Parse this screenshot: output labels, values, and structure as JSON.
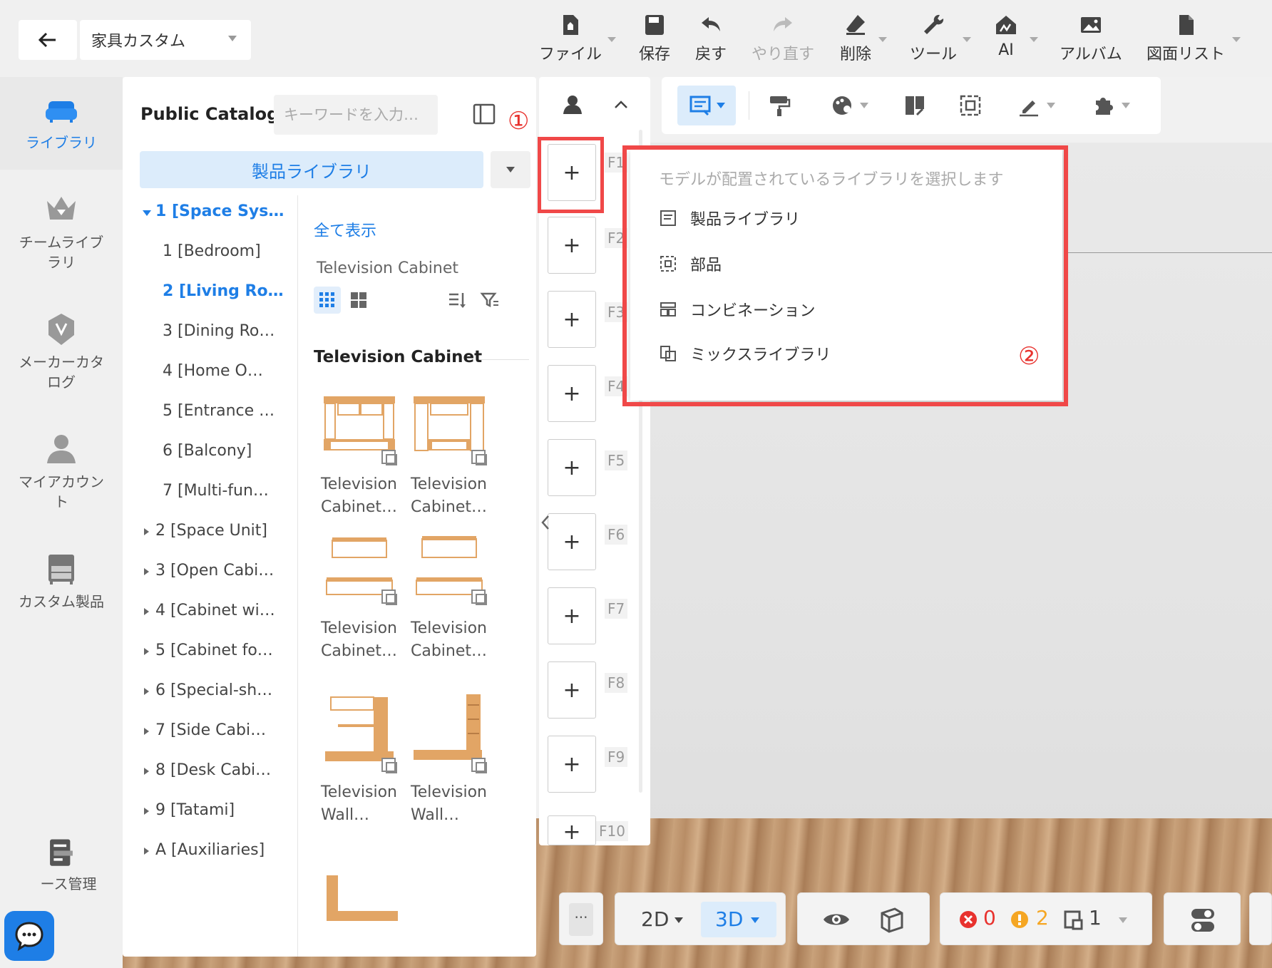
{
  "header": {
    "project_name": "家具カスタム",
    "tools": [
      {
        "label": "ファイル"
      },
      {
        "label": "保存"
      },
      {
        "label": "戻す"
      },
      {
        "label": "やり直す"
      },
      {
        "label": "削除"
      },
      {
        "label": "ツール"
      },
      {
        "label": "AI"
      },
      {
        "label": "アルバム"
      },
      {
        "label": "図面リスト"
      }
    ]
  },
  "sidebar": {
    "items": [
      {
        "label": "ライブラリ"
      },
      {
        "label": "チームライブラリ"
      },
      {
        "label": "メーカーカタログ"
      },
      {
        "label": "マイアカウント"
      },
      {
        "label": "カスタム製品"
      },
      {
        "label": "ース管理"
      }
    ]
  },
  "catalog": {
    "title": "Public Catalog",
    "search_placeholder": "キーワードを入力…",
    "annotation_1": "①",
    "library_select": "製品ライブラリ",
    "tree": [
      "1 [Space Sys…",
      "1 [Bedroom]",
      "2 [Living Ro…",
      "3 [Dining Ro…",
      "4 [Home O…",
      "5 [Entrance …",
      "6 [Balcony]",
      "7 [Multi-fun…",
      "2 [Space Unit]",
      "3 [Open Cabi…",
      "4 [Cabinet wi…",
      "5 [Cabinet fo…",
      "6 [Special-sh…",
      "7 [Side Cabi…",
      "8 [Desk Cabi…",
      "9 [Tatami]",
      "A [Auxiliaries]"
    ],
    "show_all": "全て表示",
    "breadcrumb": "Television Cabinet",
    "section_title": "Television Cabinet",
    "products": [
      {
        "line1": "Television",
        "line2": "Cabinet…"
      },
      {
        "line1": "Television",
        "line2": "Cabinet…"
      },
      {
        "line1": "Television",
        "line2": "Cabinet…"
      },
      {
        "line1": "Television",
        "line2": "Cabinet…"
      },
      {
        "line1": "Television",
        "line2": "Wall…"
      },
      {
        "line1": "Television",
        "line2": "Wall…"
      }
    ]
  },
  "floors": {
    "keys": [
      "F1",
      "F2",
      "F3",
      "F4",
      "F5",
      "F6",
      "F7",
      "F8",
      "F9",
      "F10"
    ],
    "add_symbol": "+"
  },
  "library_menu": {
    "hint": "モデルが配置されているライブラリを選択します",
    "items": [
      {
        "label": "製品ライブラリ"
      },
      {
        "label": "部品"
      },
      {
        "label": "コンビネーション"
      },
      {
        "label": "ミックスライブラリ"
      }
    ],
    "annotation_2": "②"
  },
  "bottom_bar": {
    "more": "···",
    "view_2d": "2D",
    "view_3d": "3D",
    "errors": "0",
    "warnings": "2",
    "info": "1"
  },
  "colors": {
    "accent": "#1e7ee6",
    "highlight": "#f04848",
    "error": "#e8322e",
    "warning": "#f5a623"
  }
}
